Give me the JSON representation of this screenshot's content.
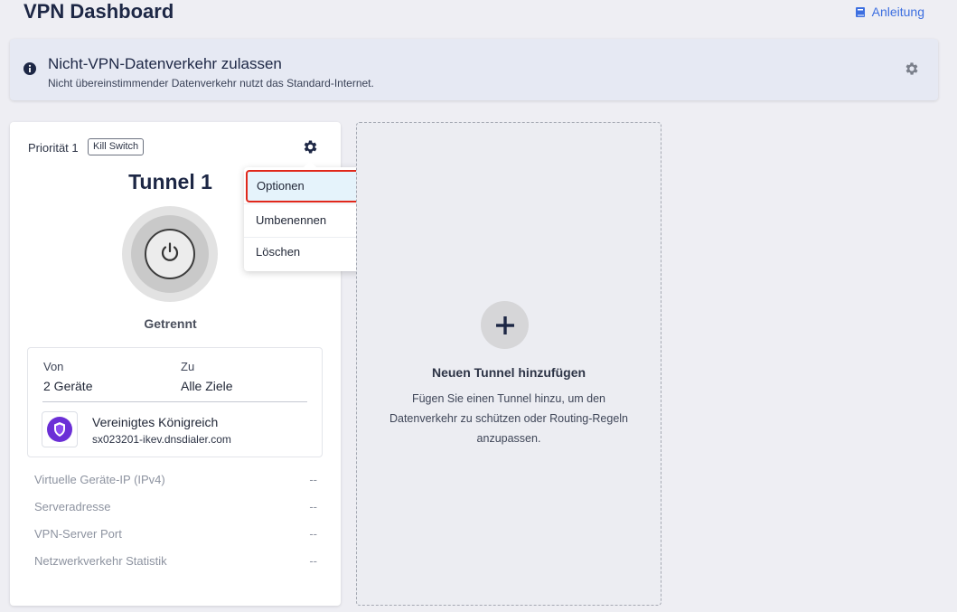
{
  "header": {
    "title": "VPN Dashboard",
    "guide_label": "Anleitung",
    "guide_icon": "book-icon"
  },
  "banner": {
    "title": "Nicht-VPN-Datenverkehr zulassen",
    "subtitle": "Nicht übereinstimmender Datenverkehr nutzt das Standard-Internet.",
    "icon": "info-icon",
    "settings_icon": "gear-icon"
  },
  "tunnel": {
    "priority": "Priorität 1",
    "kill_switch": "Kill Switch",
    "name": "Tunnel 1",
    "status": "Getrennt",
    "from_label": "Von",
    "from_value": "2 Geräte",
    "to_label": "Zu",
    "to_value": "Alle Ziele",
    "country": "Vereinigtes Königreich",
    "server_host": "sx023201-ikev.dnsdialer.com",
    "details": [
      {
        "label": "Virtuelle Geräte-IP (IPv4)",
        "value": "--"
      },
      {
        "label": "Serveradresse",
        "value": "--"
      },
      {
        "label": "VPN-Server Port",
        "value": "--"
      },
      {
        "label": "Netzwerkverkehr Statistik",
        "value": "--"
      }
    ]
  },
  "menu": {
    "items": [
      "Optionen",
      "Umbenennen",
      "Löschen"
    ],
    "highlighted": "Optionen"
  },
  "add_tunnel": {
    "title": "Neuen Tunnel hinzufügen",
    "line1": "Fügen Sie einen Tunnel hinzu, um den",
    "line2": "Datenverkehr zu schützen oder Routing-Regeln",
    "line3": "anzupassen."
  },
  "colors": {
    "accent": "#3d6fe0",
    "highlight_border": "#e0281b",
    "shield": "#6b2fd6"
  }
}
